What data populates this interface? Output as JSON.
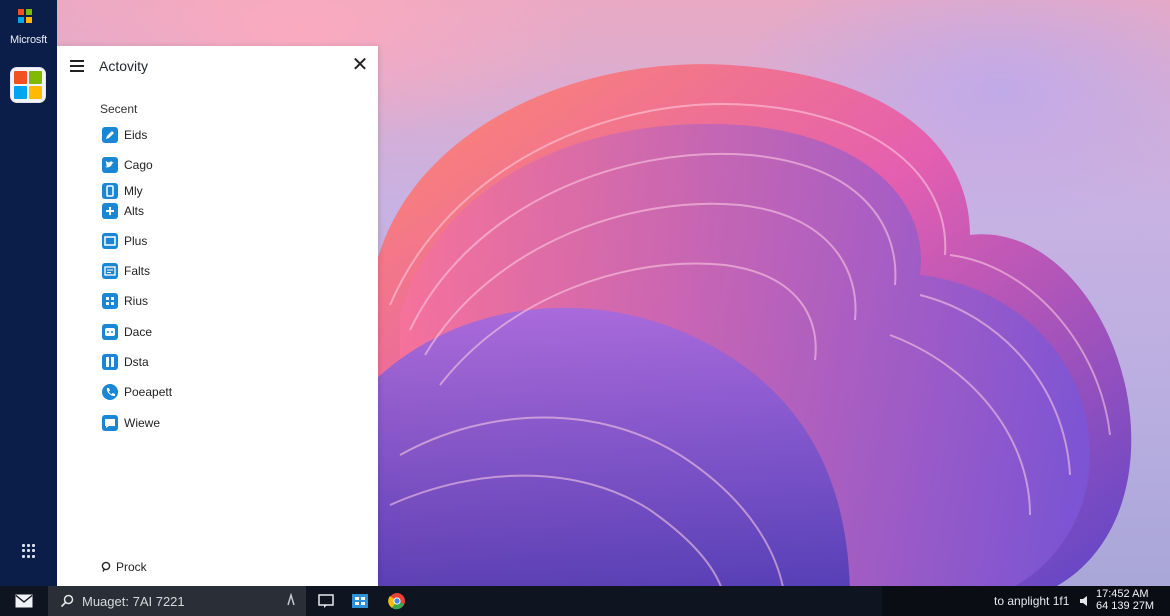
{
  "left_rail": {
    "brand": "Microsft",
    "logo_colors": [
      "#f25022",
      "#7fba00",
      "#00a4ef",
      "#ffb900"
    ]
  },
  "activity_panel": {
    "title": "Actovity",
    "section_label": "Secent",
    "items": [
      {
        "label": "Eids",
        "icon": "edit-icon"
      },
      {
        "label": "Cago",
        "icon": "twitter-bird-icon"
      },
      {
        "label": "Mly",
        "icon": "phone-icon"
      },
      {
        "label": "Alts",
        "icon": "plus-icon"
      },
      {
        "label": "Plus",
        "icon": "window-icon"
      },
      {
        "label": "Falts",
        "icon": "card-icon"
      },
      {
        "label": "Rius",
        "icon": "grid-icon"
      },
      {
        "label": "Dace",
        "icon": "chat-icon"
      },
      {
        "label": "Dsta",
        "icon": "columns-icon"
      },
      {
        "label": "Poeapett",
        "icon": "phone-call-icon"
      },
      {
        "label": "Wiewe",
        "icon": "message-icon"
      }
    ],
    "footer_label": "Prock"
  },
  "taskbar": {
    "search_text": "Muaget: 7AI 7221",
    "tray_text": "to anplight 1f1",
    "time": "17:452 AM",
    "date": "64 139 27M"
  },
  "colors": {
    "accent": "#1a87d6",
    "rail": "#0b1e4a",
    "taskbar": "#0f1520"
  }
}
